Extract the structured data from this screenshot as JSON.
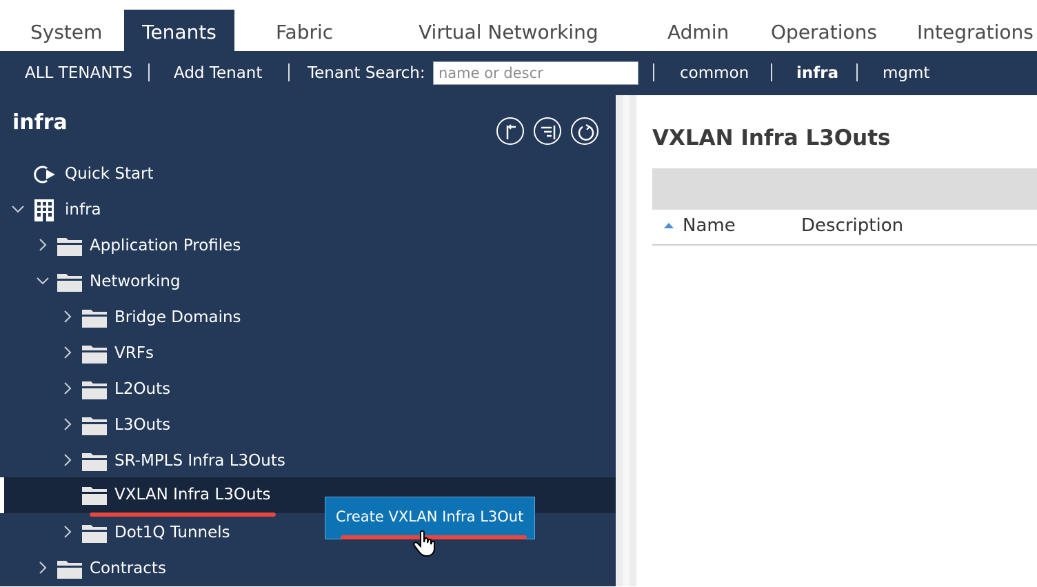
{
  "top_tabs": [
    {
      "label": "System"
    },
    {
      "label": "Tenants",
      "active": true
    },
    {
      "label": "Fabric"
    },
    {
      "label": "Virtual Networking"
    },
    {
      "label": "Admin"
    },
    {
      "label": "Operations"
    },
    {
      "label": "Integrations"
    }
  ],
  "sub_nav": {
    "all_tenants": "ALL TENANTS",
    "add_tenant": "Add Tenant",
    "search_label": "Tenant Search:",
    "search_placeholder": "name or descr",
    "tenants": [
      "common",
      "infra",
      "mgmt"
    ]
  },
  "left_pane": {
    "title": "infra",
    "tree": [
      {
        "label": "Quick Start",
        "icon": "quick-start-icon"
      },
      {
        "label": "infra",
        "icon": "building-icon",
        "expanded": true
      },
      {
        "label": "Application Profiles",
        "icon": "folder-icon"
      },
      {
        "label": "Networking",
        "icon": "folder-icon",
        "expanded": true
      },
      {
        "label": "Bridge Domains",
        "icon": "folder-icon"
      },
      {
        "label": "VRFs",
        "icon": "folder-icon"
      },
      {
        "label": "L2Outs",
        "icon": "folder-icon"
      },
      {
        "label": "L3Outs",
        "icon": "folder-icon"
      },
      {
        "label": "SR-MPLS Infra L3Outs",
        "icon": "folder-icon"
      },
      {
        "label": "VXLAN Infra L3Outs",
        "icon": "folder-icon",
        "selected": true
      },
      {
        "label": "Dot1Q Tunnels",
        "icon": "folder-icon"
      },
      {
        "label": "Contracts",
        "icon": "folder-icon"
      }
    ]
  },
  "context_menu": {
    "item": "Create VXLAN Infra L3Out"
  },
  "right_pane": {
    "title": "VXLAN Infra L3Outs",
    "columns": [
      "Name",
      "Description"
    ]
  },
  "colors": {
    "nav_dark": "#243858",
    "selected_row": "#17263d",
    "popup_blue": "#0d73b5",
    "highlight_red": "#e8463f"
  }
}
